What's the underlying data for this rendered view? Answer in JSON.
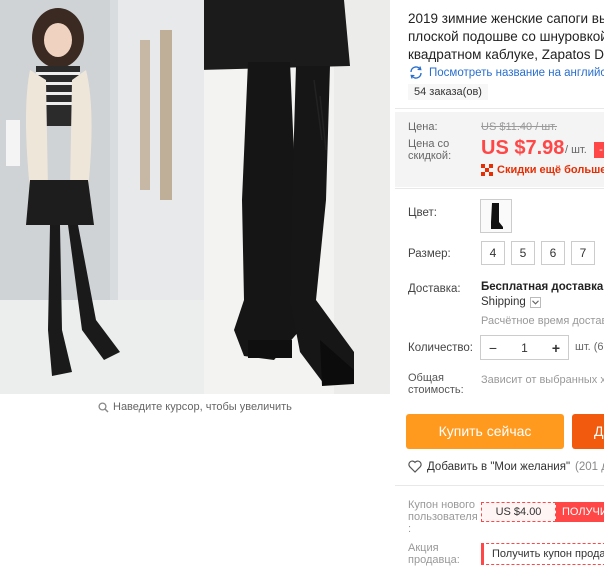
{
  "gallery": {
    "hover_hint": "Наведите курсор, чтобы увеличить"
  },
  "product": {
    "title_lines": [
      "2019 зимние женские сапоги вы",
      "плоской подошве со шнуровкой",
      "квадратном каблуке, Zapatos De"
    ],
    "translate_link": "Посмотреть название на английс",
    "orders": "54 заказа(ов)"
  },
  "price": {
    "label": "Цена:",
    "old_value": "US $11.40 / шт.",
    "discount_label_line1": "Цена со",
    "discount_label_line2": "скидкой:",
    "new_value": "US $7.98",
    "per_unit": "/ шт.",
    "discount_tag": "-",
    "app_discount": "Скидки ещё больше в"
  },
  "options": {
    "color_label": "Цвет:",
    "size_label": "Размер:",
    "sizes": [
      "4",
      "5",
      "6",
      "7"
    ]
  },
  "shipping": {
    "label": "Доставка:",
    "free": "Бесплатная доставка в",
    "method": "Shipping",
    "estimate": "Расчётное время доставки"
  },
  "quantity": {
    "label": "Количество:",
    "minus": "−",
    "value": "1",
    "plus": "+",
    "unit": "шт. (6"
  },
  "total": {
    "label_line1": "Общая",
    "label_line2": "стоимость:",
    "value": "Зависит от выбранных х"
  },
  "actions": {
    "buy_now": "Купить сейчас",
    "add_to_cart": "Д",
    "wishlist": "Добавить в \"Мои желания\"",
    "wishlist_count": "(201 до"
  },
  "coupons": {
    "new_user_label": [
      "Купон нового",
      "пользователя",
      ":"
    ],
    "new_user_value": "US $4.00",
    "new_user_get": "ПОЛУЧИ",
    "seller_label": [
      "Акция",
      "продавца:"
    ],
    "seller_get": "Получить купон прода"
  },
  "colors": {
    "accent_red": "#ff4747",
    "buy_orange": "#ff9a1e",
    "cart_orange": "#f25a0d",
    "link_blue": "#2a6fce"
  }
}
